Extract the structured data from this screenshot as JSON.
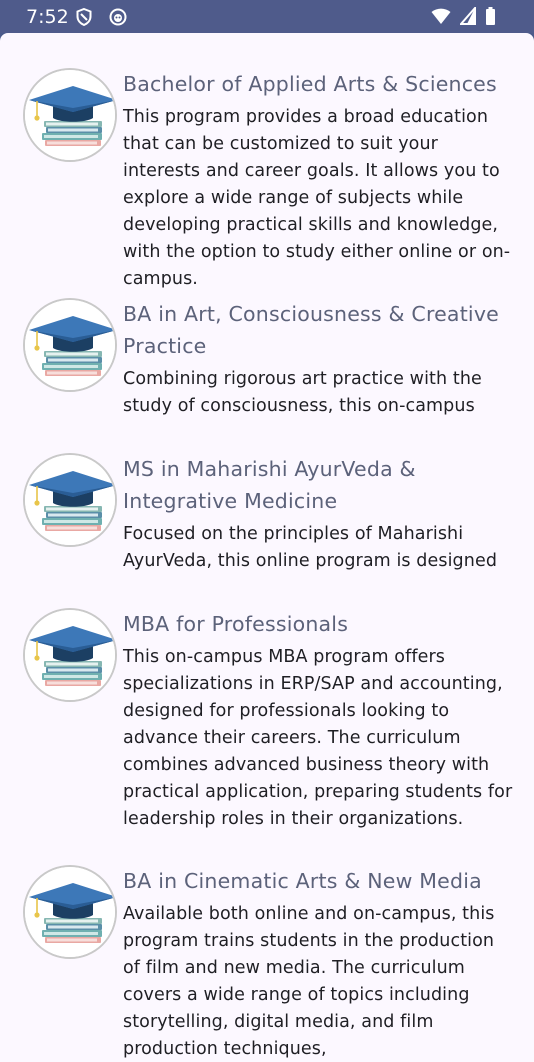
{
  "status_bar": {
    "time": "7:52",
    "icons_left": [
      "shield-icon",
      "face-icon"
    ],
    "icons_right": [
      "wifi-icon",
      "cellular-icon",
      "battery-icon"
    ]
  },
  "programs": [
    {
      "title": "Bachelor of Applied Arts & Sciences",
      "description": "This program provides a broad education that can be customized to suit your interests and career goals. It allows you to explore a wide range of subjects while developing practical skills and knowledge, with the option to study either online or on-campus."
    },
    {
      "title": "BA in Art, Consciousness & Creative Practice",
      "description": "Combining rigorous art practice with the study of consciousness, this on-campus"
    },
    {
      "title": "MS in Maharishi AyurVeda & Integrative Medicine",
      "description": "Focused on the principles of Maharishi AyurVeda, this online program is designed for"
    },
    {
      "title": "MBA for Professionals",
      "description": "This on-campus MBA program offers specializations in ERP/SAP and accounting, designed for professionals looking to advance their careers. The curriculum combines advanced business theory with practical application, preparing students for leadership roles in their organizations."
    },
    {
      "title": "BA in Cinematic Arts & New Media",
      "description": "Available both online and on-campus, this program trains students in the production of film and new media. The curriculum covers a wide range of topics including storytelling, digital media, and film production techniques,"
    }
  ],
  "colors": {
    "status_bar": "#4f5b8b",
    "background": "#fcf8ff",
    "title": "#5c627a",
    "body_text": "#1f1f24"
  }
}
